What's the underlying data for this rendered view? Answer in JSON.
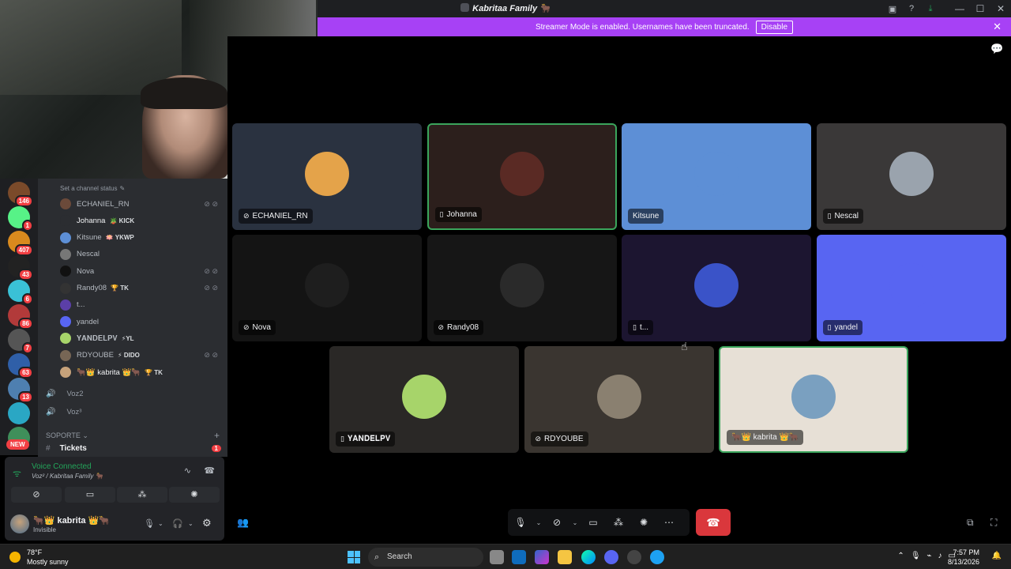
{
  "window": {
    "title": "Kabritaa Family 🐂",
    "icons": [
      "inbox-icon",
      "help-icon",
      "download-icon"
    ],
    "controls": [
      "—",
      "☐",
      "✕"
    ]
  },
  "banner": {
    "text": "Streamer Mode is enabled. Usernames have been truncated.",
    "disable_label": "Disable",
    "color": "#a741f5"
  },
  "servers": [
    {
      "badge": "146",
      "color": "#7a4a2a"
    },
    {
      "badge": "1",
      "color": "#57f287"
    },
    {
      "badge": "407",
      "color": "#d98a1e"
    },
    {
      "badge": "43",
      "color": "#222"
    },
    {
      "badge": "6",
      "color": "#3ac1d6"
    },
    {
      "badge": "86",
      "color": "#b23a3a"
    },
    {
      "badge": "7",
      "color": "#555"
    },
    {
      "badge": "63",
      "color": "#2f5fa8"
    },
    {
      "badge": "13",
      "color": "#4e7fb0"
    },
    {
      "badge": "",
      "color": "#2aa7c4"
    },
    {
      "badge": "",
      "color": "#3f8f5a"
    }
  ],
  "new_label": "NEW",
  "channel_status": "Set a channel status",
  "voice_members": [
    {
      "name": "ECHANIEL_RN",
      "tag": "",
      "deaf": true,
      "color": "#6b4a3a"
    },
    {
      "name": "Johanna",
      "tag": "🪴 KICK",
      "deaf": false,
      "color": "#2b2d31"
    },
    {
      "name": "Kitsune",
      "tag": "🪷 YKWP",
      "deaf": false,
      "color": "#5d8fd6"
    },
    {
      "name": "Nescal",
      "tag": "",
      "deaf": false,
      "color": "#777"
    },
    {
      "name": "Nova",
      "tag": "",
      "deaf": true,
      "color": "#111"
    },
    {
      "name": "Randy08",
      "tag": "🏆 TK",
      "deaf": true,
      "color": "#333"
    },
    {
      "name": "t...",
      "tag": "",
      "deaf": false,
      "color": "#5b3fa8"
    },
    {
      "name": "yandel",
      "tag": "",
      "deaf": false,
      "color": "#5865f2"
    },
    {
      "name": "𝐘𝐀𝐍𝐃𝐄𝐋𝐏𝐕",
      "tag": "⚡YL",
      "deaf": false,
      "color": "#a7d46a"
    },
    {
      "name": "RDYOUBE",
      "tag": "⚡ DIDO",
      "deaf": true,
      "color": "#776655"
    },
    {
      "name": "🐂👑 kabrita 👑🐂",
      "tag": "🏆 TK",
      "deaf": false,
      "color": "#c6a27b"
    }
  ],
  "voice_channels": [
    {
      "name": "Voz2"
    },
    {
      "name": "Voz³"
    }
  ],
  "category": "SOPORTE",
  "ticket_channel": {
    "name": "Tickets",
    "badge": "1"
  },
  "voice_panel": {
    "status": "Voice Connected",
    "location": "Voz² / Kabritaa Family 🐂",
    "buttons": [
      "camera-off-icon",
      "screen-share-icon",
      "activities-icon",
      "soundboard-icon"
    ]
  },
  "user_panel": {
    "name": "🐂👑 kabrita 👑🐂",
    "status": "Invisible"
  },
  "tiles": [
    {
      "name": "ECHANIEL_RN",
      "bg": "#2a3240",
      "avatar": "#e4a34a",
      "icon": "deafened-icon",
      "speaking": false
    },
    {
      "name": "Johanna",
      "bg": "#2c1f1c",
      "avatar": "#5a2a24",
      "icon": "mobile-icon",
      "speaking": true
    },
    {
      "name": "Kitsune",
      "bg": "#5d8fd6",
      "avatar": "#5d8fd6",
      "icon": "",
      "speaking": false
    },
    {
      "name": "Nescal",
      "bg": "#3a3838",
      "avatar": "#9aa3ad",
      "icon": "mobile-icon",
      "speaking": false
    },
    {
      "name": "Nova",
      "bg": "#141414",
      "avatar": "#1e1e1e",
      "icon": "deafened-icon",
      "speaking": false
    },
    {
      "name": "Randy08",
      "bg": "#161616",
      "avatar": "#2a2a2a",
      "icon": "deafened-icon",
      "speaking": false
    },
    {
      "name": "t...",
      "bg": "#1c1530",
      "avatar": "#3a53c8",
      "icon": "mobile-icon",
      "speaking": false
    },
    {
      "name": "yandel",
      "bg": "#5865f2",
      "avatar": "#5865f2",
      "icon": "mobile-icon",
      "speaking": false
    },
    {
      "name": "𝐘𝐀𝐍𝐃𝐄𝐋𝐏𝐕",
      "bg": "#2a2826",
      "avatar": "#a7d46a",
      "icon": "mobile-icon",
      "speaking": false
    },
    {
      "name": "RDYOUBE",
      "bg": "#3a3530",
      "avatar": "#8a8070",
      "icon": "deafened-icon",
      "speaking": false
    },
    {
      "name": "🐂👑 kabrita 👑🐂",
      "bg": "#e7e0d6",
      "avatar": "#7aa0c0",
      "icon": "",
      "speaking": true
    }
  ],
  "taskbar": {
    "temp": "78°F",
    "weather": "Mostly sunny",
    "search": "Search",
    "time": "7:57 PM",
    "date": "8/13/2026"
  }
}
